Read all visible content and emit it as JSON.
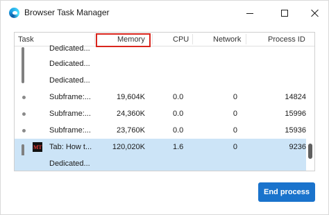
{
  "window": {
    "title": "Browser Task Manager",
    "icon": "edge-browser-icon"
  },
  "table": {
    "columns": {
      "task": "Task",
      "memory": "Memory",
      "cpu": "CPU",
      "network": "Network",
      "process_id": "Process ID"
    },
    "highlight_color": "#d9251d",
    "rows": [
      {
        "name": "Dedicated...",
        "memory": "",
        "cpu": "",
        "network": "",
        "pid": ""
      },
      {
        "name": "Dedicated...",
        "memory": "",
        "cpu": "",
        "network": "",
        "pid": ""
      },
      {
        "name": "Dedicated...",
        "memory": "",
        "cpu": "",
        "network": "",
        "pid": ""
      },
      {
        "name": "Subframe:...",
        "memory": "19,604K",
        "cpu": "0.0",
        "network": "0",
        "pid": "14824"
      },
      {
        "name": "Subframe:...",
        "memory": "24,360K",
        "cpu": "0.0",
        "network": "0",
        "pid": "15996"
      },
      {
        "name": "Subframe:...",
        "memory": "23,760K",
        "cpu": "0.0",
        "network": "0",
        "pid": "15936"
      },
      {
        "name": "Tab: How t...",
        "memory": "120,020K",
        "cpu": "1.6",
        "network": "0",
        "pid": "9236",
        "favicon_text": "MT"
      },
      {
        "name": "Dedicated...",
        "memory": "",
        "cpu": "",
        "network": "",
        "pid": ""
      }
    ]
  },
  "actions": {
    "end_process": "End process"
  },
  "colors": {
    "selection": "#cce4f7",
    "accent": "#1a73cc"
  }
}
